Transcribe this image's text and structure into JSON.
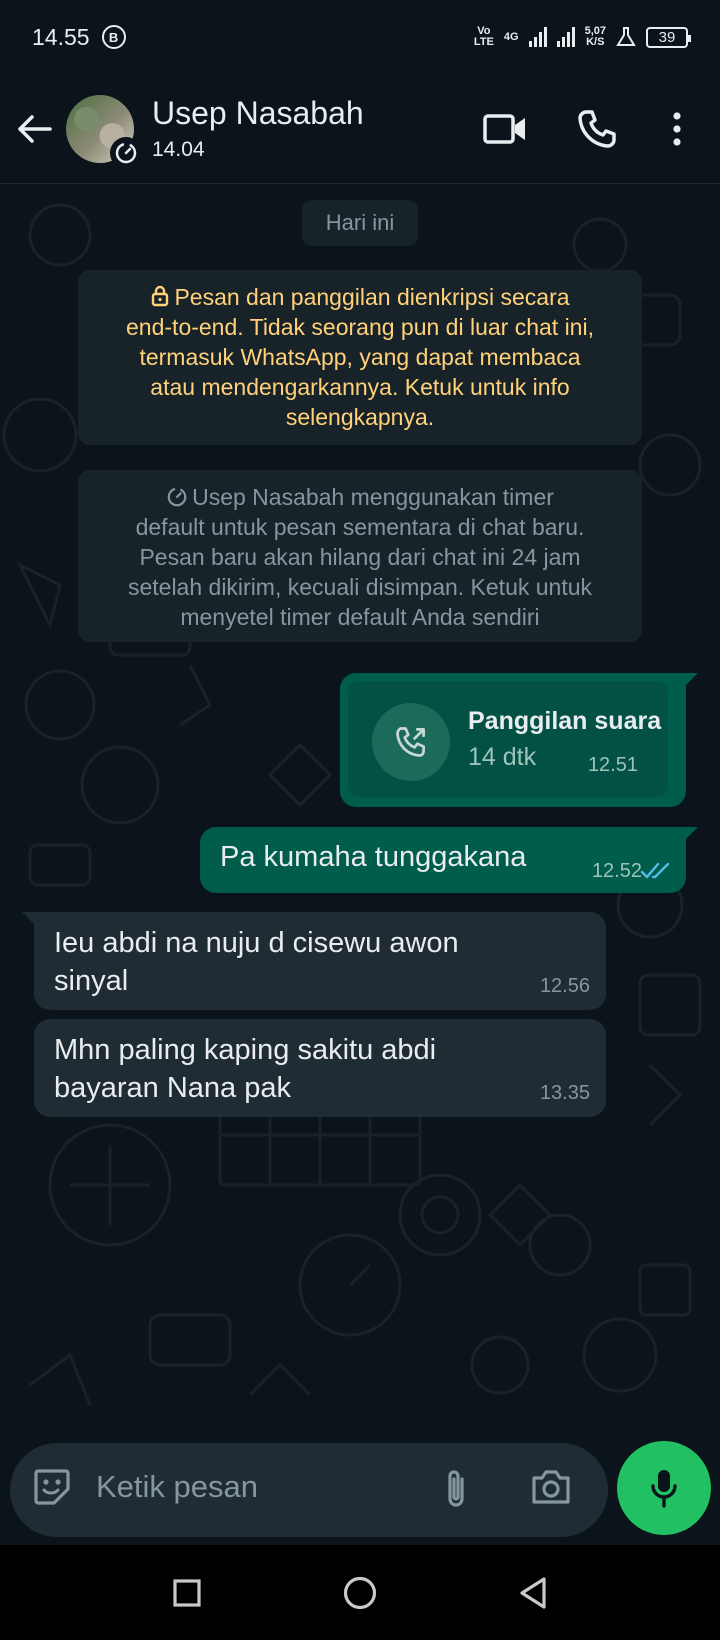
{
  "status_bar": {
    "time": "14.55",
    "app_badge": "B",
    "volte": "Vo",
    "lte": "LTE",
    "net_type": "4G",
    "speed_value": "5,07",
    "speed_unit": "K/S",
    "battery": "39"
  },
  "header": {
    "contact_name": "Usep Nasabah",
    "subtitle": "14.04",
    "icons": [
      "back-arrow-icon",
      "video-call-icon",
      "phone-icon",
      "more-icon"
    ]
  },
  "chat": {
    "date_label": "Hari ini",
    "encryption_notice": "🔒 Pesan dan panggilan dienkripsi secara end-to-end. Tidak seorang pun di luar chat ini, termasuk WhatsApp, yang dapat membaca atau mendengarkannya. Ketuk untuk info selengkapnya.",
    "encryption_lines": [
      "Pesan dan panggilan dienkripsi secara",
      "end-to-end. Tidak seorang pun di luar chat ini,",
      "termasuk WhatsApp, yang dapat membaca",
      "atau mendengarkannya. Ketuk untuk info",
      "selengkapnya."
    ],
    "timer_lines": [
      "Usep Nasabah menggunakan timer",
      "default untuk pesan sementara di chat baru.",
      "Pesan baru akan hilang dari chat ini 24 jam",
      "setelah dikirim, kecuali disimpan. Ketuk untuk",
      "menyetel timer default Anda sendiri"
    ],
    "call_message": {
      "title": "Panggilan suara",
      "duration": "14 dtk",
      "time": "12.51"
    },
    "outgoing_message": {
      "text": "Pa kumaha tunggakana",
      "time": "12.52"
    },
    "incoming_messages": [
      {
        "lines": [
          "Ieu abdi na nuju d cisewu awon",
          "sinyal"
        ],
        "time": "12.56"
      },
      {
        "lines": [
          "Mhn paling kaping sakitu abdi",
          "bayaran Nana pak"
        ],
        "time": "13.35"
      }
    ]
  },
  "input": {
    "placeholder": "Ketik pesan"
  },
  "colors": {
    "background": "#0b141a",
    "outgoing_bubble": "#005c4b",
    "incoming_bubble": "#202c33",
    "system_notice_text": "#ffd279",
    "mic_button": "#21c063",
    "read_ticks": "#53bdeb"
  }
}
